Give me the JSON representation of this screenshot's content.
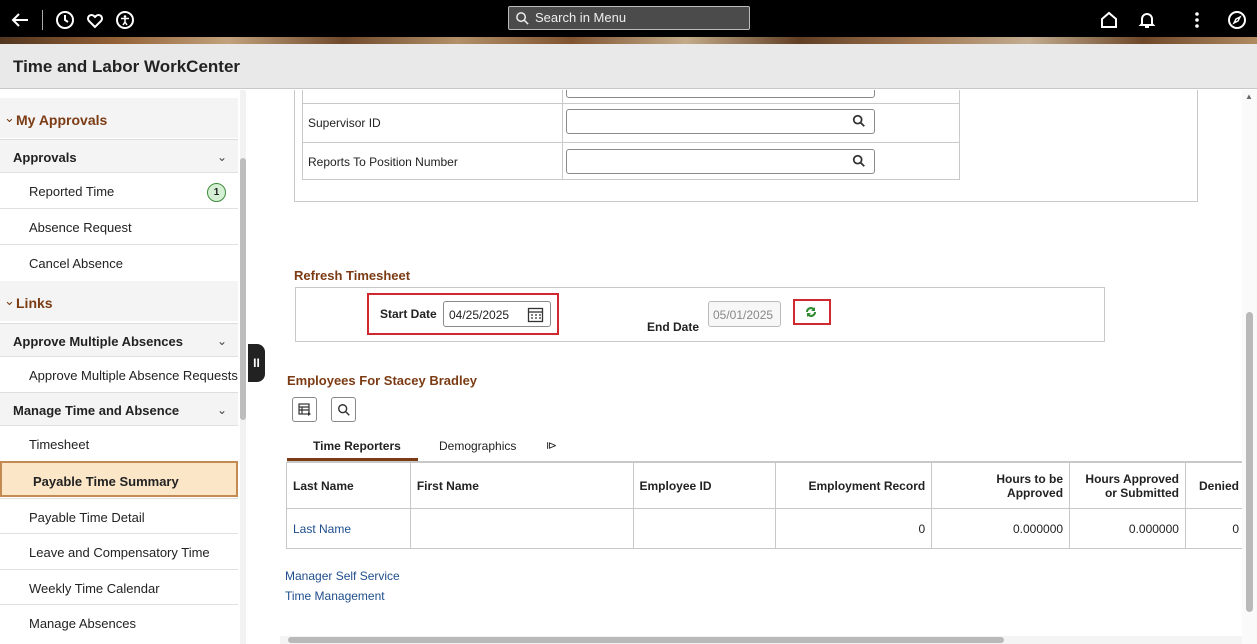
{
  "topbar": {
    "search_placeholder": "Search in Menu"
  },
  "page_title": "Time and Labor WorkCenter",
  "sidebar": {
    "my_approvals": "My Approvals",
    "approvals_group": "Approvals",
    "reported_time": "Reported Time",
    "reported_time_badge": "1",
    "absence_request": "Absence Request",
    "cancel_absence": "Cancel Absence",
    "links": "Links",
    "approve_multiple_absences": "Approve Multiple Absences",
    "approve_multiple_absence_requests": "Approve Multiple Absence Requests",
    "manage_time_and_absence": "Manage Time and Absence",
    "timesheet": "Timesheet",
    "payable_time_summary": "Payable Time Summary",
    "payable_time_detail": "Payable Time Detail",
    "leave_and_compensatory_time": "Leave and Compensatory Time",
    "weekly_time_calendar": "Weekly Time Calendar",
    "manage_absences": "Manage Absences"
  },
  "criteria": {
    "supervisor_id_label": "Supervisor ID",
    "reports_to_label": "Reports To Position Number"
  },
  "refresh": {
    "title": "Refresh Timesheet",
    "start_date_label": "Start Date",
    "start_date_value": "04/25/2025",
    "end_date_label": "End Date",
    "end_date_value": "05/01/2025"
  },
  "employees": {
    "title": "Employees For Stacey Bradley",
    "tabs": [
      "Time Reporters",
      "Demographics"
    ],
    "columns": [
      "Last Name",
      "First Name",
      "Employee ID",
      "Employment Record",
      "Hours to be Approved",
      "Hours Approved or Submitted",
      "Denied"
    ],
    "rows": [
      {
        "last_name": "Last Name",
        "first_name": "",
        "employee_id": "",
        "employment_record": "0",
        "hours_to_be_approved": "0.000000",
        "hours_approved": "0.000000",
        "denied": "0"
      }
    ]
  },
  "footer_links": [
    "Manager Self Service",
    "Time Management"
  ],
  "colors": {
    "accent_brown": "#7b3b14",
    "link_blue": "#1f4e8c",
    "highlight_red": "#d0282e",
    "active_item_bg": "#fbe6c8"
  }
}
